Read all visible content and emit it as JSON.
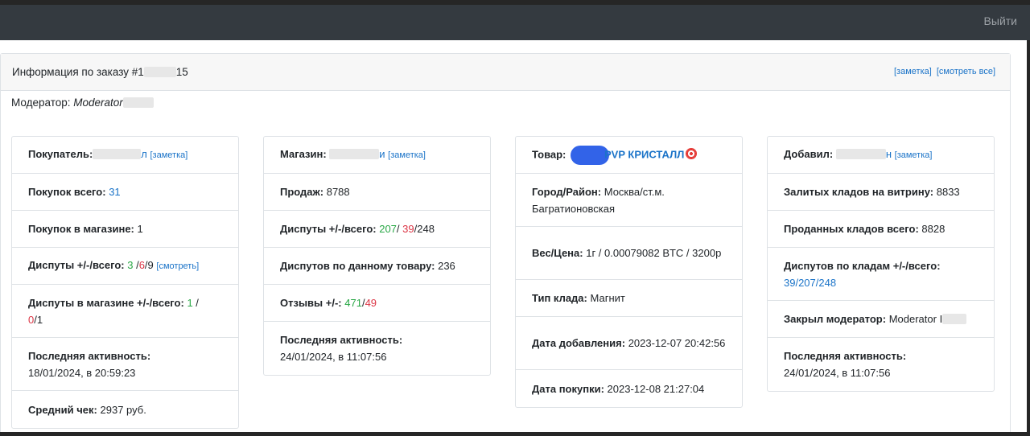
{
  "topbar": {
    "logout_label": "Выйти"
  },
  "order": {
    "title_prefix": "Информация по заказу #1",
    "title_suffix": "15",
    "link_note": "[заметка]",
    "link_view_all": "[смотреть все]",
    "moderator_label": "Модератор: ",
    "moderator_value": "Moderator"
  },
  "buyer": {
    "buyer_label": "Покупатель:",
    "buyer_suffix": "л",
    "buyer_note": "[заметка]",
    "purchases_total_label": "Покупок всего:",
    "purchases_total_value": "31",
    "purchases_in_shop_label": "Покупок в магазине:",
    "purchases_in_shop_value": "1",
    "disputes_label": "Диспуты +/-/всего:",
    "disputes_plus": "3",
    "disputes_minus": "6",
    "disputes_total": "9",
    "disputes_link": "[смотреть]",
    "disputes_shop_label": "Диспуты в магазине +/-/всего:",
    "disputes_shop_plus": "1",
    "disputes_shop_minus": "0",
    "disputes_shop_total": "1",
    "last_activity_label": "Последняя активность:",
    "last_activity_value": "18/01/2024, в 20:59:23",
    "avg_check_label": "Средний чек:",
    "avg_check_value": "2937 руб."
  },
  "shop": {
    "shop_label": "Магазин:",
    "shop_suffix": "и",
    "shop_note": "[заметка]",
    "sales_label": "Продаж:",
    "sales_value": "8788",
    "disputes_label": "Диспуты +/-/всего:",
    "disputes_plus": "207",
    "disputes_minus": "39",
    "disputes_total": "248",
    "disputes_product_label": "Диспутов по данному товару:",
    "disputes_product_value": "236",
    "reviews_label": "Отзывы +/-:",
    "reviews_plus": "471",
    "reviews_minus": "49",
    "last_activity_label": "Последняя активность:",
    "last_activity_value": "24/01/2024, в 11:07:56"
  },
  "product": {
    "product_label": "Товар:",
    "product_name": "PVP КРИСТАЛЛ",
    "city_label": "Город/Район:",
    "city_value": "Москва/ст.м. Багратионовская",
    "weight_label": "Вес/Цена:",
    "weight_value": "1г / 0.00079082 BTC / 3200р",
    "type_label": "Тип клада:",
    "type_value": "Магнит",
    "added_label": "Дата добавления:",
    "added_value": "2023-12-07 20:42:56",
    "bought_label": "Дата покупки:",
    "bought_value": "2023-12-08 21:27:04"
  },
  "added_by": {
    "added_label": "Добавил:",
    "added_suffix": "н",
    "added_note": "[заметка]",
    "stocked_label": "Залитых кладов на витрину:",
    "stocked_value": "8833",
    "sold_label": "Проданных кладов всего:",
    "sold_value": "8828",
    "disputes_label": "Диспутов по кладам +/-/всего:",
    "disputes_value": "39/207/248",
    "closed_label": "Закрыл модератор:",
    "closed_value": "Moderator I",
    "last_activity_label": "Последняя активность:",
    "last_activity_value": "24/01/2024, в 11:07:56"
  },
  "colors": {
    "topbar": "#343a40",
    "link": "#1a73c8",
    "green": "#28a745",
    "red": "#dc3545",
    "product_pill": "#3263e8"
  }
}
